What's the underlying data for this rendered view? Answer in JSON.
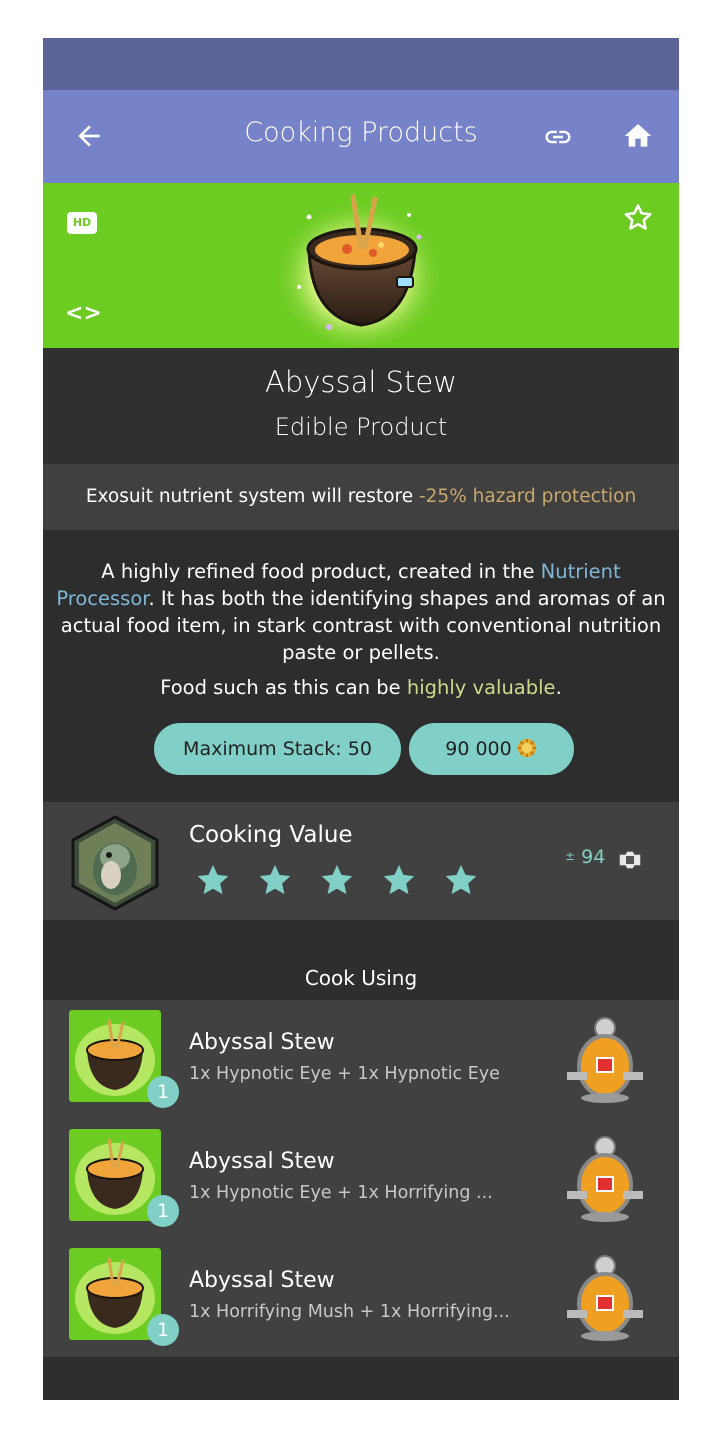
{
  "header": {
    "title": "Cooking Products"
  },
  "hero": {
    "badge": "HD",
    "code_symbol": "<>"
  },
  "item": {
    "name": "Abyssal Stew",
    "type": "Edible Product"
  },
  "effect": {
    "prefix": "Exosuit nutrient system will restore ",
    "highlight": "-25% hazard protection"
  },
  "description": {
    "part1": "A highly refined food product, created in the ",
    "link": "Nutrient Processor",
    "part2": ". It has both the identifying shapes and aromas of an actual food item, in stark contrast with conventional nutrition paste or pellets.",
    "value_prefix": "Food such as this can be ",
    "value_highlight": "highly valuable",
    "value_suffix": "."
  },
  "stats": {
    "max_stack_label": "Maximum Stack: 50",
    "price": "90 000"
  },
  "cooking": {
    "label": "Cooking Value",
    "stars": 5,
    "value_prefix": "±",
    "value": "94"
  },
  "cook_using": {
    "title": "Cook Using",
    "recipes": [
      {
        "name": "Abyssal Stew",
        "ingredients": "1x Hypnotic Eye + 1x Hypnotic Eye",
        "quantity": "1"
      },
      {
        "name": "Abyssal Stew",
        "ingredients": "1x Hypnotic Eye + 1x Horrifying ...",
        "quantity": "1"
      },
      {
        "name": "Abyssal Stew",
        "ingredients": "1x Horrifying Mush + 1x Horrifying...",
        "quantity": "1"
      }
    ]
  },
  "colors": {
    "statusbar": "#5b6399",
    "appbar": "#7683c9",
    "hero_green": "#6ccc22",
    "accent_teal": "#80d0c7",
    "hazard_gold": "#c9a86a",
    "link_blue": "#7fb7d8"
  }
}
